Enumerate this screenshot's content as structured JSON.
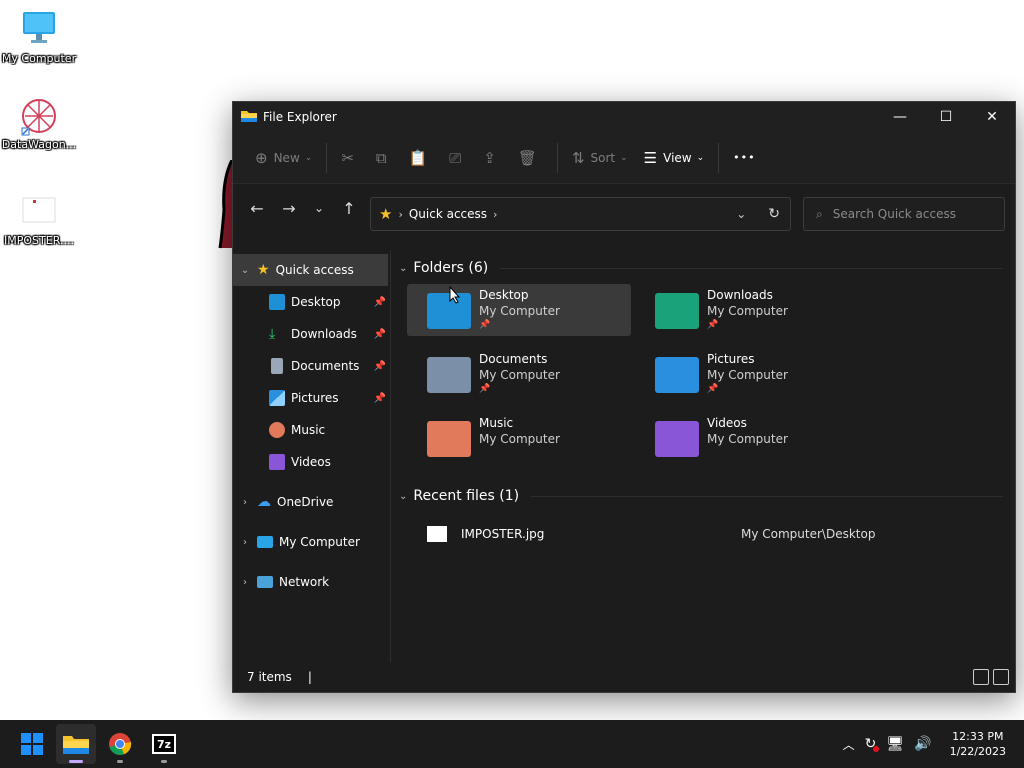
{
  "desktop": {
    "icons": [
      {
        "label": "My Computer",
        "icon": "monitor-icon"
      },
      {
        "label": "DataWagon...",
        "icon": "datawagon-icon"
      },
      {
        "label": "IMPOSTER....",
        "icon": "image-file-icon"
      }
    ]
  },
  "window": {
    "title": "File Explorer",
    "controls": {
      "minimize": "—",
      "maximize": "☐",
      "close": "✕"
    }
  },
  "commandbar": {
    "new_label": "New",
    "sort_label": "Sort",
    "view_label": "View",
    "more_label": "•••"
  },
  "address": {
    "crumb": "Quick access",
    "search_placeholder": "Search Quick access"
  },
  "sidebar": {
    "quick_access": "Quick access",
    "items": [
      {
        "label": "Desktop",
        "pinned": true
      },
      {
        "label": "Downloads",
        "pinned": true
      },
      {
        "label": "Documents",
        "pinned": true
      },
      {
        "label": "Pictures",
        "pinned": true
      },
      {
        "label": "Music",
        "pinned": false
      },
      {
        "label": "Videos",
        "pinned": false
      }
    ],
    "roots": [
      {
        "label": "OneDrive"
      },
      {
        "label": "My Computer"
      },
      {
        "label": "Network"
      }
    ]
  },
  "main": {
    "folders_header": "Folders (6)",
    "folders": [
      {
        "name": "Desktop",
        "location": "My Computer",
        "pinned": true,
        "color": "#1f8fd6"
      },
      {
        "name": "Downloads",
        "location": "My Computer",
        "pinned": true,
        "color": "#1aa37a"
      },
      {
        "name": "Documents",
        "location": "My Computer",
        "pinned": true,
        "color": "#7c8fa8"
      },
      {
        "name": "Pictures",
        "location": "My Computer",
        "pinned": true,
        "color": "#2b8fe0"
      },
      {
        "name": "Music",
        "location": "My Computer",
        "pinned": false,
        "color": "#e07a5a"
      },
      {
        "name": "Videos",
        "location": "My Computer",
        "pinned": false,
        "color": "#8a56d8"
      }
    ],
    "recent_header": "Recent files (1)",
    "recent": [
      {
        "name": "IMPOSTER.jpg",
        "path": "My Computer\\Desktop"
      }
    ]
  },
  "status": {
    "items": "7 items"
  },
  "taskbar": {
    "time": "12:33 PM",
    "date": "1/22/2023",
    "apps": [
      "start-icon",
      "file-explorer-icon",
      "chrome-icon",
      "7zip-icon"
    ]
  }
}
